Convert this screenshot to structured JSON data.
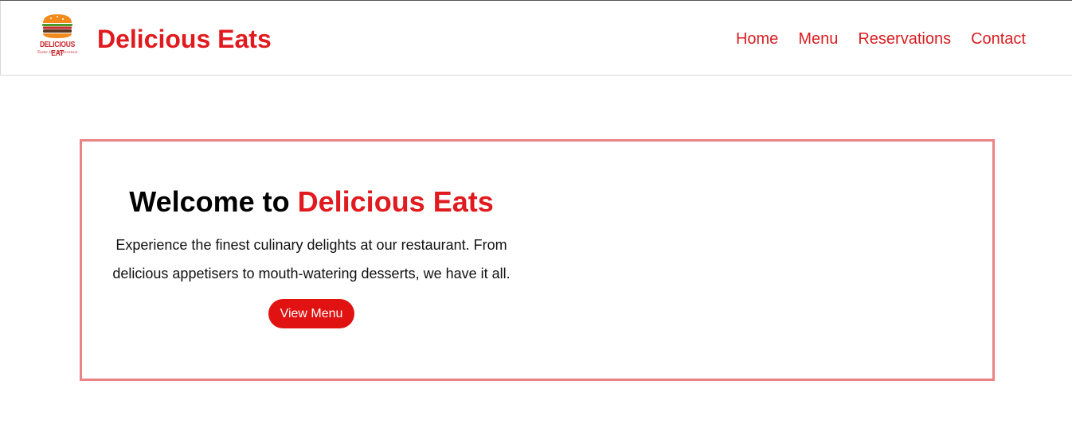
{
  "header": {
    "brand": "Delicious Eats",
    "logo": {
      "icon": "burger-icon",
      "text": "DELICIOUS EAT",
      "tagline": "Taste the Difference"
    },
    "nav": [
      "Home",
      "Menu",
      "Reservations",
      "Contact"
    ]
  },
  "hero": {
    "title_prefix": "Welcome to ",
    "title_accent": "Delicious Eats",
    "description": "Experience the finest culinary delights at our restaurant. From delicious appetisers to mouth-watering desserts, we have it all.",
    "button_label": "View Menu"
  },
  "colors": {
    "brand_red": "#e01a1e",
    "hero_border": "#ea8386",
    "button_bg": "#e01212"
  }
}
